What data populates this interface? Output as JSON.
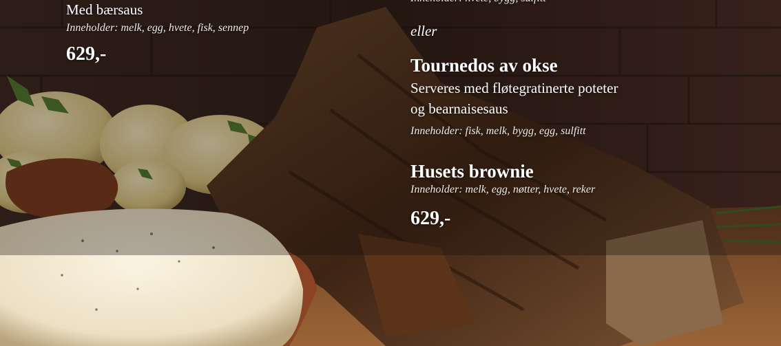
{
  "left_item": {
    "description": "Med bærsaus",
    "allergens": "Inneholder: melk, egg, hvete, fisk, sennep",
    "price": "629,-"
  },
  "right_column": {
    "top_allergens_partial": "Inneholder: hvete, bygg, sulfitt",
    "separator": "eller",
    "tournedos": {
      "title": "Tournedos av okse",
      "description_line1": "Serveres med fløtegratinerte poteter",
      "description_line2": "og bearnaisesaus",
      "allergens": "Inneholder: fisk, melk, bygg, egg, sulfitt"
    },
    "brownie": {
      "title": "Husets brownie",
      "allergens": "Inneholder: melk, egg, nøtter, hvete, reker"
    },
    "price": "629,-"
  },
  "colors": {
    "text": "#ffffff",
    "brick": "#4a2a22",
    "board": "#8a5630",
    "potato": "#e8d9a0",
    "meat": "#4a2b18"
  }
}
